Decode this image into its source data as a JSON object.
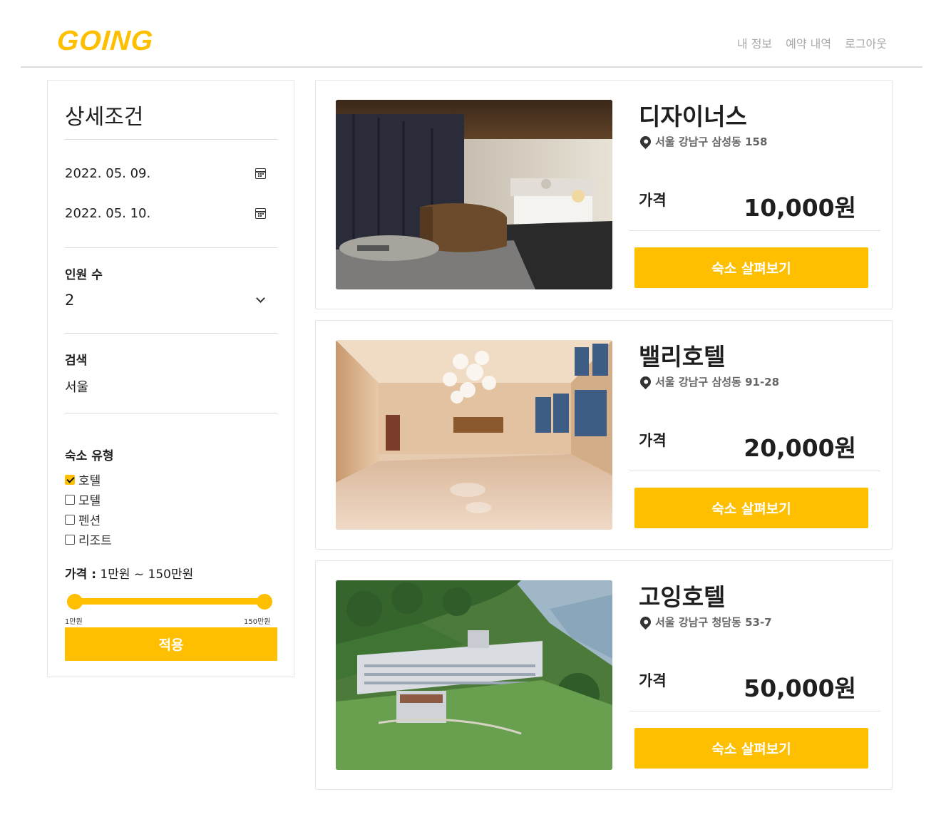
{
  "header": {
    "logo": "GOING",
    "nav": [
      "내 정보",
      "예약 내역",
      "로그아웃"
    ]
  },
  "sidebar": {
    "title": "상세조건",
    "checkin": "2022. 05. 09.",
    "checkout": "2022. 05. 10.",
    "guests_label": "인원 수",
    "guests_value": "2",
    "search_label": "검색",
    "search_value": "서울",
    "type_label": "숙소 유형",
    "types": [
      {
        "label": "호텔",
        "checked": true
      },
      {
        "label": "모텔",
        "checked": false
      },
      {
        "label": "펜션",
        "checked": false
      },
      {
        "label": "리조트",
        "checked": false
      }
    ],
    "price_label": "가격 :",
    "price_range": "1만원 ~ 150만원",
    "slider_min": "1만원",
    "slider_max": "150만원",
    "apply": "적용"
  },
  "listings": [
    {
      "name": "디자이너스",
      "address": "서울 강남구 삼성동 158",
      "price_label": "가격",
      "price": "10,000원",
      "button": "숙소 살펴보기"
    },
    {
      "name": "밸리호텔",
      "address": "서울 강남구 삼성동 91-28",
      "price_label": "가격",
      "price": "20,000원",
      "button": "숙소 살펴보기"
    },
    {
      "name": "고잉호텔",
      "address": "서울 강남구 청담동 53-7",
      "price_label": "가격",
      "price": "50,000원",
      "button": "숙소 살펴보기"
    }
  ],
  "colors": {
    "accent": "#fdbf00"
  }
}
